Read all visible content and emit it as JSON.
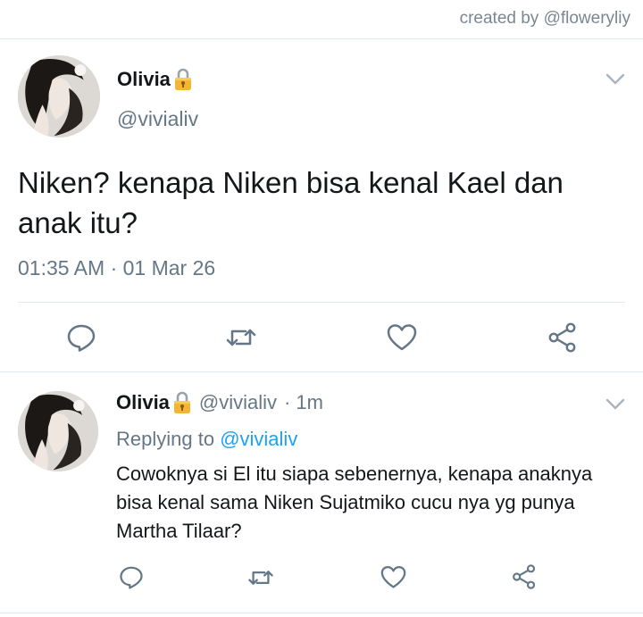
{
  "credit": "created by @floweryliy",
  "main_tweet": {
    "display_name": "Olivia",
    "handle": "@vivialiv",
    "text": "Niken? kenapa Niken bisa kenal Kael dan anak itu?",
    "timestamp": "01:35 AM · 01 Mar 26",
    "icons": [
      "lock-icon",
      "chevron-down-icon",
      "reply-icon",
      "retweet-icon",
      "like-icon",
      "share-icon"
    ]
  },
  "reply_tweet": {
    "display_name": "Olivia",
    "handle": "@vivialiv",
    "separator": "·",
    "time": "1m",
    "replying_prefix": "Replying to",
    "replying_to": "@vivialiv",
    "text": "Cowoknya si El itu siapa sebenernya, kenapa anaknya bisa kenal sama Niken Sujatmiko cucu nya yg punya Martha Tilaar?",
    "icons": [
      "lock-icon",
      "chevron-down-icon",
      "reply-icon",
      "retweet-icon",
      "like-icon",
      "share-icon"
    ]
  },
  "colors": {
    "text_primary": "#14171a",
    "text_secondary": "#657786",
    "link": "#1da1f2",
    "divider": "#e1e8ed",
    "lock": "#f2b632"
  }
}
